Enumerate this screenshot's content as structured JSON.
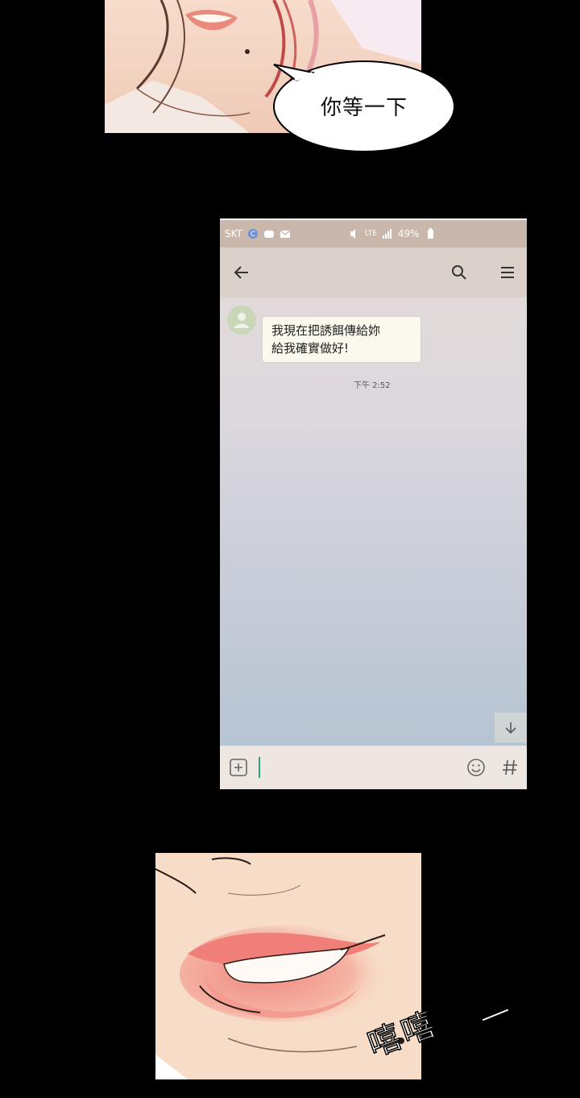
{
  "panel_top": {
    "speech_text": "你等一下"
  },
  "phone": {
    "status_bar": {
      "carrier": "SKT",
      "network": "LTE",
      "battery": "49%"
    },
    "message": {
      "lines": [
        "我現在把誘餌傳給妳",
        "給我確實做好!"
      ],
      "time": "下午 2:52"
    },
    "colors": {
      "caret": "#2aa878",
      "bubble": "#fbf8ee"
    }
  },
  "panel_bottom": {
    "sfx": "嘻嘻"
  }
}
